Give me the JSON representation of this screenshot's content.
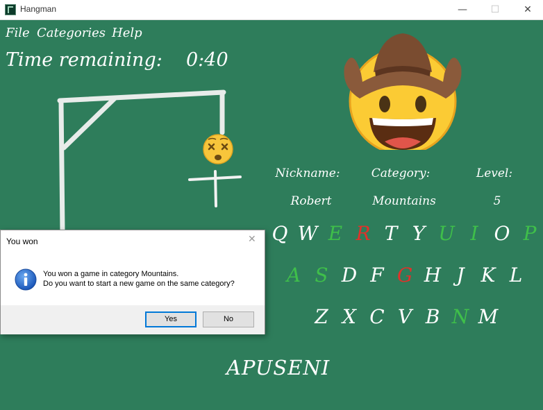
{
  "window": {
    "title": "Hangman",
    "minimize_glyph": "—",
    "maximize_glyph": "☐",
    "close_glyph": "✕"
  },
  "menu": [
    "File",
    "Categories",
    "Help"
  ],
  "timer": {
    "label": "Time remaining:",
    "value": "0:40"
  },
  "player": {
    "nickname_label": "Nickname:",
    "nickname": "Robert",
    "category_label": "Category:",
    "category": "Mountains",
    "level_label": "Level:",
    "level": "5"
  },
  "keyboard": [
    [
      {
        "letter": "Q",
        "state": "unused"
      },
      {
        "letter": "W",
        "state": "unused"
      },
      {
        "letter": "E",
        "state": "correct"
      },
      {
        "letter": "R",
        "state": "wrong"
      },
      {
        "letter": "T",
        "state": "unused"
      },
      {
        "letter": "Y",
        "state": "unused"
      },
      {
        "letter": "U",
        "state": "correct"
      },
      {
        "letter": "I",
        "state": "correct"
      },
      {
        "letter": "O",
        "state": "unused"
      },
      {
        "letter": "P",
        "state": "correct"
      }
    ],
    [
      {
        "letter": "A",
        "state": "correct"
      },
      {
        "letter": "S",
        "state": "correct"
      },
      {
        "letter": "D",
        "state": "unused"
      },
      {
        "letter": "F",
        "state": "unused"
      },
      {
        "letter": "G",
        "state": "wrong"
      },
      {
        "letter": "H",
        "state": "unused"
      },
      {
        "letter": "J",
        "state": "unused"
      },
      {
        "letter": "K",
        "state": "unused"
      },
      {
        "letter": "L",
        "state": "unused"
      }
    ],
    [
      {
        "letter": "Z",
        "state": "unused"
      },
      {
        "letter": "X",
        "state": "unused"
      },
      {
        "letter": "C",
        "state": "unused"
      },
      {
        "letter": "V",
        "state": "unused"
      },
      {
        "letter": "B",
        "state": "unused"
      },
      {
        "letter": "N",
        "state": "correct"
      },
      {
        "letter": "M",
        "state": "unused"
      }
    ]
  ],
  "word": "APUSENI",
  "colors": {
    "board": "#2e7d5b",
    "chalk": "#ffffff",
    "correct": "#3fbf4a",
    "wrong": "#e0312a",
    "dialog_accent": "#0078d7"
  },
  "icons": {
    "avatar": "cowboy-hat-face-icon",
    "hanged_head": "dizzy-face-icon",
    "dialog": "information-icon"
  },
  "dialog": {
    "title": "You won",
    "close_glyph": "✕",
    "line1": "You won a game in category Mountains.",
    "line2": "Do you want to start a new game on the same category?",
    "yes_label": "Yes",
    "no_label": "No"
  }
}
